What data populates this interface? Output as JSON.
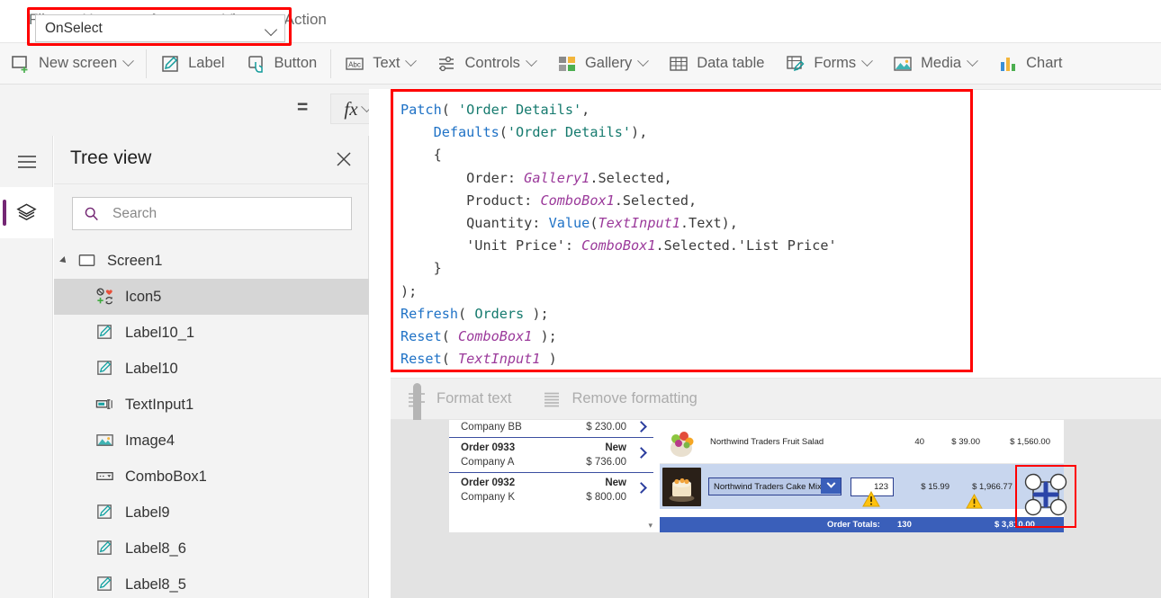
{
  "menubar": {
    "items": [
      {
        "label": "File",
        "active": false
      },
      {
        "label": "Home",
        "active": false
      },
      {
        "label": "Insert",
        "active": true
      },
      {
        "label": "View",
        "active": false
      },
      {
        "label": "Action",
        "active": false
      }
    ]
  },
  "ribbon": {
    "items": [
      {
        "label": "New screen",
        "icon": "new-screen-icon",
        "caret": true
      },
      {
        "label": "Label",
        "icon": "label-icon",
        "caret": false
      },
      {
        "label": "Button",
        "icon": "button-icon",
        "caret": false
      },
      {
        "label": "Text",
        "icon": "text-icon",
        "caret": true
      },
      {
        "label": "Controls",
        "icon": "controls-icon",
        "caret": true
      },
      {
        "label": "Gallery",
        "icon": "gallery-icon",
        "caret": true
      },
      {
        "label": "Data table",
        "icon": "data-table-icon",
        "caret": false
      },
      {
        "label": "Forms",
        "icon": "forms-icon",
        "caret": true
      },
      {
        "label": "Media",
        "icon": "media-icon",
        "caret": true
      },
      {
        "label": "Chart",
        "icon": "chart-icon",
        "caret": false
      }
    ]
  },
  "formula_bar": {
    "property_selected": "OnSelect",
    "equals": "=",
    "fx_label": "fx",
    "formula_text": "Patch( 'Order Details',\n    Defaults('Order Details'),\n    {\n        Order: Gallery1.Selected,\n        Product: ComboBox1.Selected,\n        Quantity: Value(TextInput1.Text),\n        'Unit Price': ComboBox1.Selected.'List Price'\n    }\n);\nRefresh( Orders );\nReset( ComboBox1 );\nReset( TextInput1 )"
  },
  "format_bar": {
    "format_text": "Format text",
    "remove_formatting": "Remove formatting"
  },
  "tree_view": {
    "title": "Tree view",
    "close_icon": "close-icon",
    "search_placeholder": "Search",
    "root": {
      "label": "Screen1",
      "icon": "screen-icon"
    },
    "items": [
      {
        "label": "Icon5",
        "icon": "icon-control-icon",
        "selected": true
      },
      {
        "label": "Label10_1",
        "icon": "label-icon",
        "selected": false
      },
      {
        "label": "Label10",
        "icon": "label-icon",
        "selected": false
      },
      {
        "label": "TextInput1",
        "icon": "text-input-icon",
        "selected": false
      },
      {
        "label": "Image4",
        "icon": "image-icon",
        "selected": false
      },
      {
        "label": "ComboBox1",
        "icon": "combobox-icon",
        "selected": false
      },
      {
        "label": "Label9",
        "icon": "label-icon",
        "selected": false
      },
      {
        "label": "Label8_6",
        "icon": "label-icon",
        "selected": false
      },
      {
        "label": "Label8_5",
        "icon": "label-icon",
        "selected": false
      }
    ]
  },
  "canvas": {
    "orders_gallery": [
      {
        "order": "",
        "status": "",
        "company": "Company BB",
        "amount": "$ 230.00",
        "partial": true
      },
      {
        "order": "Order 0933",
        "status": "New",
        "company": "Company A",
        "amount": "$ 736.00",
        "partial": false
      },
      {
        "order": "Order 0932",
        "status": "New",
        "company": "Company K",
        "amount": "$ 800.00",
        "partial": false
      }
    ],
    "order_details": [
      {
        "product": "Northwind Traders Fruit Salad",
        "quantity": "40",
        "unit_price": "$ 39.00",
        "total": "$ 1,560.00",
        "selected": false,
        "thumb": "fruit-salad-thumb"
      },
      {
        "product": "Northwind Traders Cake Mix",
        "quantity": "123",
        "unit_price": "$ 15.99",
        "total": "$ 1,966.77",
        "selected": true,
        "thumb": "cake-mix-thumb"
      }
    ],
    "totals": {
      "label": "Order Totals:",
      "quantity": "130",
      "amount": "$ 3,810.00"
    },
    "selected_control_icon": "add-plus-icon"
  },
  "colors": {
    "accent_purple": "#742774",
    "highlight_red": "#ff0000",
    "formula_function": "#1f72c6",
    "formula_string": "#157a6e",
    "formula_control": "#9b3a9b",
    "app_blue": "#3a5fba"
  }
}
